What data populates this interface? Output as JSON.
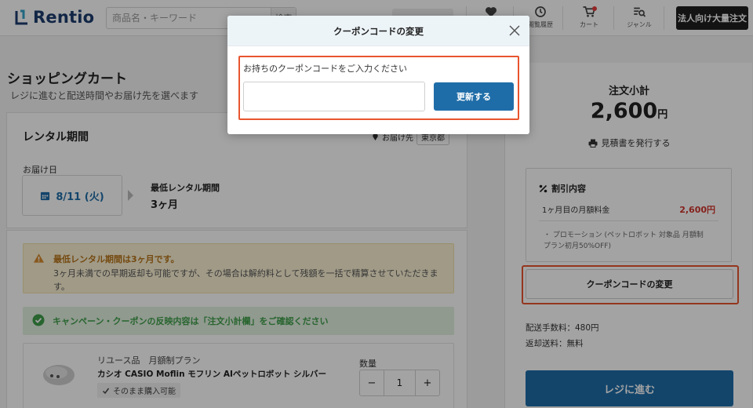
{
  "header": {
    "logo_text": "Rentio",
    "search_placeholder": "商品名・キーワード",
    "search_button": "検索",
    "icons": [
      {
        "name": "heart-icon",
        "label": ""
      },
      {
        "name": "history-icon",
        "label": "閲覧履歴"
      },
      {
        "name": "cart-icon",
        "label": "カート"
      },
      {
        "name": "genre-icon",
        "label": "ジャンル"
      }
    ],
    "business_button": "法人向け大量注文",
    "colors": {
      "brand": "#1d3c6e",
      "accent": "#1f6da8",
      "highlight": "#e8552f"
    }
  },
  "page": {
    "title": "ショッピングカート",
    "subtitle": "レジに進むと配送時間やお届け先を選べます"
  },
  "rental": {
    "title": "レンタル期間",
    "delivery_area_label": "お届け先",
    "delivery_area_value": "東京都",
    "delivery_date_label": "お届け日",
    "delivery_date": "8/11 (火)",
    "min_period_label": "最低レンタル期間",
    "min_period_value": "3ヶ月"
  },
  "notices": {
    "warning_title": "最低レンタル期間は3ヶ月です。",
    "warning_body": "3ヶ月未満での早期返却も可能ですが、その場合は解約料として残額を一括で精算させていただきます。",
    "info_text": "キャンペーン・クーポンの反映内容は「注文小計欄」をご確認ください"
  },
  "product": {
    "tag": "リユース品　月額制プラン",
    "name": "カシオ CASIO Moflin モフリン AIペットロボット シルバー",
    "badge": "そのまま購入可能",
    "qty_label": "数量",
    "qty_minus": "−",
    "qty_value": "1",
    "qty_plus": "+"
  },
  "summary": {
    "title": "注文小計",
    "price": "2,600",
    "currency": "円",
    "quote_link": "見積書を発行する",
    "discount_title": "割引内容",
    "discount_row_label": "1ヶ月目の月額料金",
    "discount_row_value": "2,600円",
    "discount_note": "・ プロモーション (ペットロボット 対象品 月額制プラン初月50%OFF)",
    "coupon_button": "クーポンコードの変更",
    "shipping_fee": "配送手数料：480円",
    "return_fee": "返却送料：無料",
    "checkout_button": "レジに進む"
  },
  "modal": {
    "title": "クーポンコードの変更",
    "label": "お持ちのクーポンコードをご入力ください",
    "input_value": "",
    "input_placeholder": "",
    "update_button": "更新する"
  }
}
